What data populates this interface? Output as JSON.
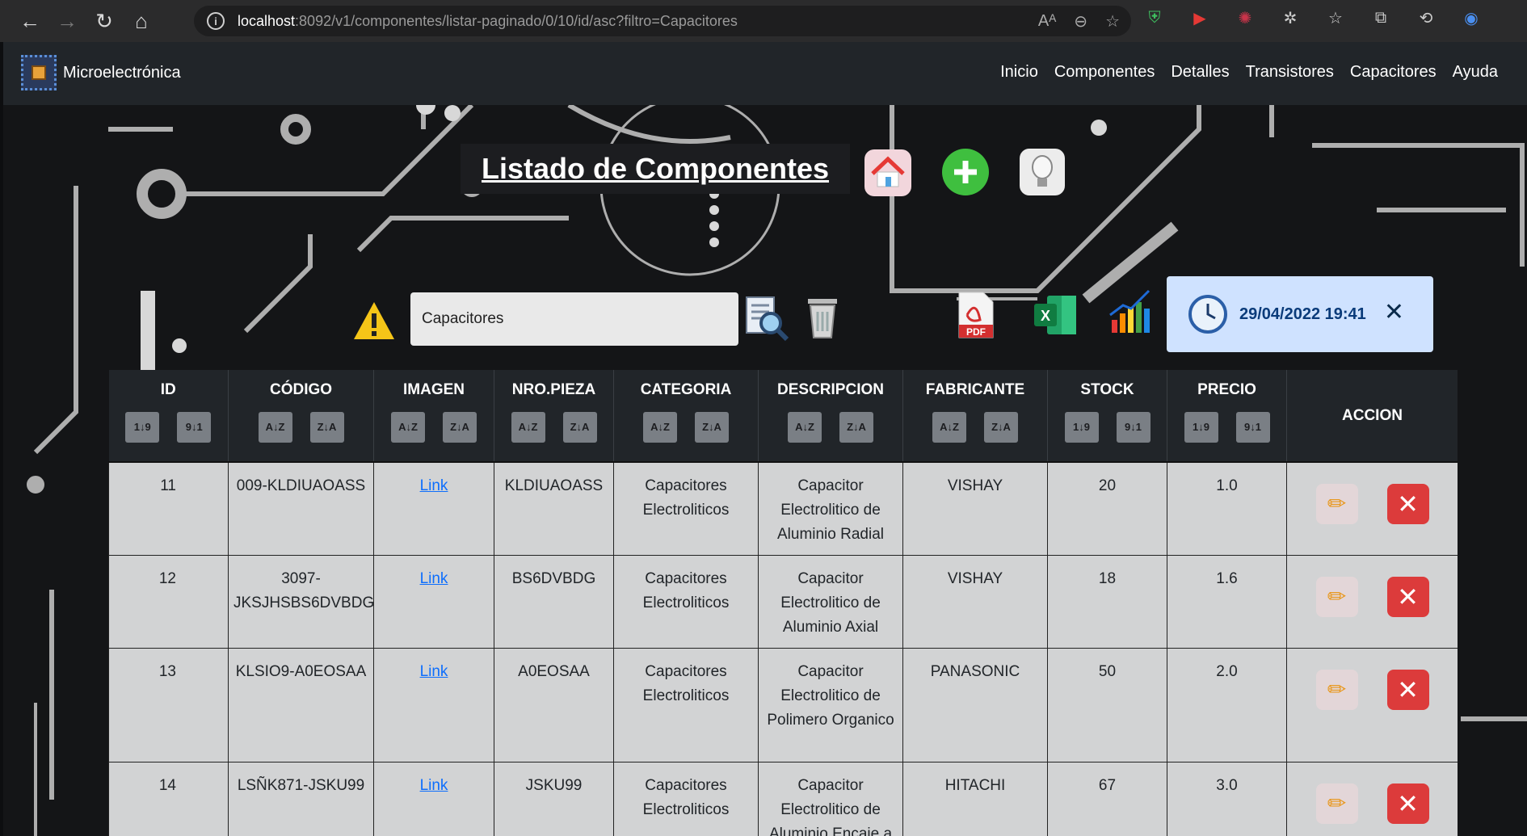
{
  "browser": {
    "url_host": "localhost",
    "url_path": ":8092/v1/componentes/listar-paginado/0/10/id/asc?filtro=Capacitores"
  },
  "navbar": {
    "brand": "Microelectrónica",
    "links": [
      "Inicio",
      "Componentes",
      "Detalles",
      "Transistores",
      "Capacitores",
      "Ayuda"
    ]
  },
  "page": {
    "title": "Listado de Componentes"
  },
  "search": {
    "value": "Capacitores"
  },
  "toast": {
    "datetime": "29/04/2022 19:41",
    "close": "✕"
  },
  "table": {
    "headers": [
      "ID",
      "CÓDIGO",
      "IMAGEN",
      "NRO.PIEZA",
      "CATEGORIA",
      "DESCRIPCION",
      "FABRICANTE",
      "STOCK",
      "PRECIO",
      "ACCION"
    ],
    "rows": [
      {
        "id": "11",
        "codigo": "009-KLDIUAOASS",
        "imagen": "Link",
        "nro_pieza": "KLDIUAOASS",
        "categoria": "Capacitores Electroliticos",
        "descripcion": "Capacitor Electrolitico de Aluminio Radial",
        "fabricante": "VISHAY",
        "stock": "20",
        "precio": "1.0"
      },
      {
        "id": "12",
        "codigo": "3097-JKSJHSBS6DVBDG",
        "imagen": "Link",
        "nro_pieza": "BS6DVBDG",
        "categoria": "Capacitores Electroliticos",
        "descripcion": "Capacitor Electrolitico de Aluminio Axial",
        "fabricante": "VISHAY",
        "stock": "18",
        "precio": "1.6"
      },
      {
        "id": "13",
        "codigo": "KLSIO9-A0EOSAA",
        "imagen": "Link",
        "nro_pieza": "A0EOSAA",
        "categoria": "Capacitores Electroliticos",
        "descripcion": "Capacitor Electrolitico de Polimero Organico",
        "fabricante": "PANASONIC",
        "stock": "50",
        "precio": "2.0"
      },
      {
        "id": "14",
        "codigo": "LSÑK871-JSKU99",
        "imagen": "Link",
        "nro_pieza": "JSKU99",
        "categoria": "Capacitores Electroliticos",
        "descripcion": "Capacitor Electrolitico de Aluminio Encaje a",
        "fabricante": "HITACHI",
        "stock": "67",
        "precio": "3.0"
      }
    ]
  },
  "colors": {
    "navbar": "#212529",
    "table_row": "#d2d3d4",
    "toast": "#cfe2ff",
    "delete": "#dc3b3b",
    "add": "#3fbf3f"
  }
}
